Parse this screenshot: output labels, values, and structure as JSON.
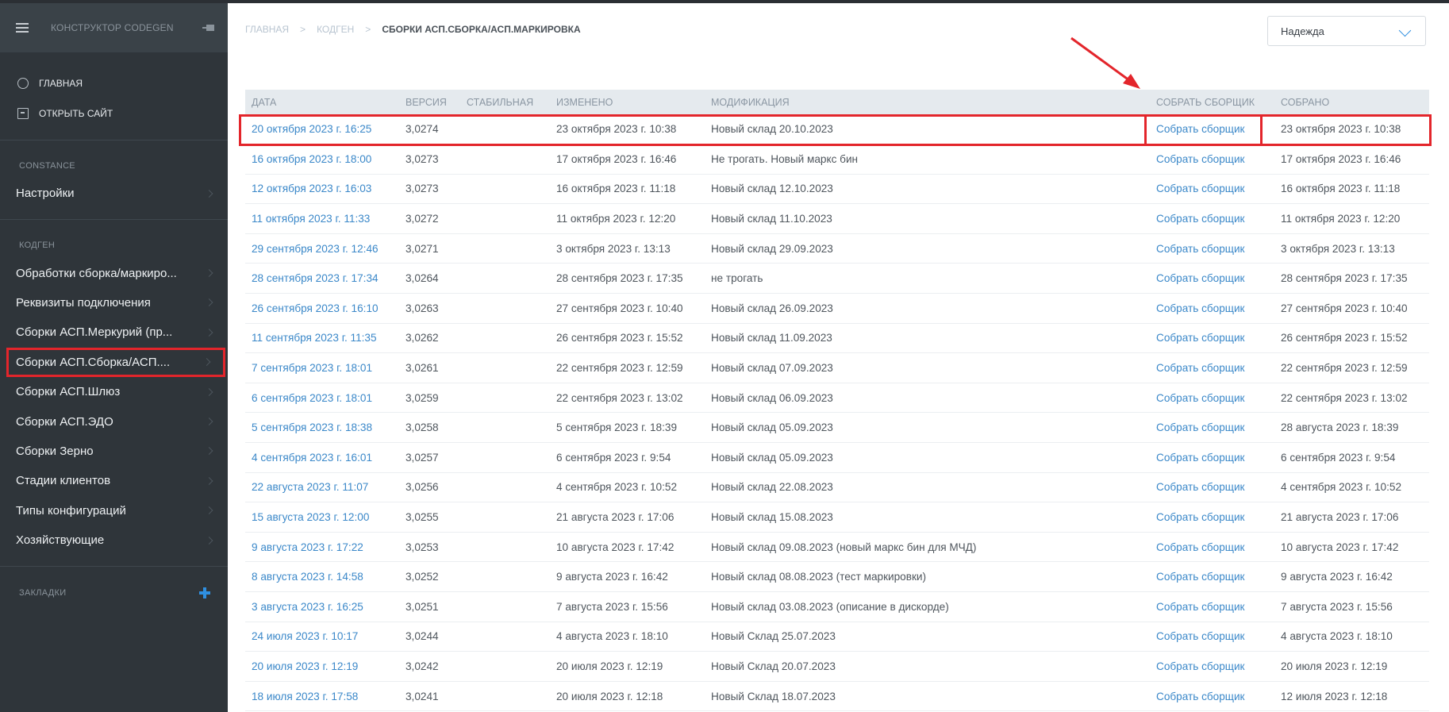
{
  "sidebar": {
    "title": "КОНСТРУКТОР CODEGEN",
    "links": [
      {
        "label": "ГЛАВНАЯ",
        "icon": "circle-icon"
      },
      {
        "label": "ОТКРЫТЬ САЙТ",
        "icon": "open-site-icon"
      }
    ],
    "sections": [
      {
        "title": "CONSTANCE",
        "items": [
          "Настройки"
        ]
      },
      {
        "title": "КОДГЕН",
        "items": [
          "Обработки сборка/маркиро...",
          "Реквизиты подключения",
          "Сборки АСП.Меркурий (пр...",
          "Сборки АСП.Сборка/АСП....",
          "Сборки АСП.Шлюз",
          "Сборки АСП.ЭДО",
          "Сборки Зерно",
          "Стадии клиентов",
          "Типы конфигураций",
          "Хозяйствующие"
        ]
      }
    ],
    "active_item": "Сборки АСП.Сборка/АСП....",
    "bookmarks_title": "ЗАКЛАДКИ"
  },
  "breadcrumb": {
    "home": "ГЛАВНАЯ",
    "section": "КОДГЕН",
    "current": "СБОРКИ АСП.СБОРКА/АСП.МАРКИРОВКА"
  },
  "user_select": {
    "value": "Надежда"
  },
  "colors": {
    "accent": "#3b88c9",
    "highlight": "#e3252b",
    "sidebar": "#2f353a"
  },
  "table": {
    "headers": {
      "date": "ДАТА",
      "version": "ВЕРСИЯ",
      "stable": "СТАБИЛЬНАЯ",
      "modified": "ИЗМЕНЕНО",
      "modification": "МОДИФИКАЦИЯ",
      "build": "СОБРАТЬ СБОРЩИК",
      "built": "СОБРАНО"
    },
    "rows": [
      {
        "date": "20 октября 2023 г. 16:25",
        "version": "3,0274",
        "stable": "",
        "modified": "23 октября 2023 г. 10:38",
        "modification": "Новый склад 20.10.2023",
        "build": "Собрать сборщик",
        "built": "23 октября 2023 г. 10:38"
      },
      {
        "date": "16 октября 2023 г. 18:00",
        "version": "3,0273",
        "stable": "",
        "modified": "17 октября 2023 г. 16:46",
        "modification": "Не трогать. Новый маркс бин",
        "build": "Собрать сборщик",
        "built": "17 октября 2023 г. 16:46"
      },
      {
        "date": "12 октября 2023 г. 16:03",
        "version": "3,0273",
        "stable": "",
        "modified": "16 октября 2023 г. 11:18",
        "modification": "Новый склад 12.10.2023",
        "build": "Собрать сборщик",
        "built": "16 октября 2023 г. 11:18"
      },
      {
        "date": "11 октября 2023 г. 11:33",
        "version": "3,0272",
        "stable": "",
        "modified": "11 октября 2023 г. 12:20",
        "modification": "Новый склад 11.10.2023",
        "build": "Собрать сборщик",
        "built": "11 октября 2023 г. 12:20"
      },
      {
        "date": "29 сентября 2023 г. 12:46",
        "version": "3,0271",
        "stable": "",
        "modified": "3 октября 2023 г. 13:13",
        "modification": "Новый склад 29.09.2023",
        "build": "Собрать сборщик",
        "built": "3 октября 2023 г. 13:13"
      },
      {
        "date": "28 сентября 2023 г. 17:34",
        "version": "3,0264",
        "stable": "",
        "modified": "28 сентября 2023 г. 17:35",
        "modification": "не трогать",
        "build": "Собрать сборщик",
        "built": "28 сентября 2023 г. 17:35"
      },
      {
        "date": "26 сентября 2023 г. 16:10",
        "version": "3,0263",
        "stable": "",
        "modified": "27 сентября 2023 г. 10:40",
        "modification": "Новый склад 26.09.2023",
        "build": "Собрать сборщик",
        "built": "27 сентября 2023 г. 10:40"
      },
      {
        "date": "11 сентября 2023 г. 11:35",
        "version": "3,0262",
        "stable": "",
        "modified": "26 сентября 2023 г. 15:52",
        "modification": "Новый склад 11.09.2023",
        "build": "Собрать сборщик",
        "built": "26 сентября 2023 г. 15:52"
      },
      {
        "date": "7 сентября 2023 г. 18:01",
        "version": "3,0261",
        "stable": "",
        "modified": "22 сентября 2023 г. 12:59",
        "modification": "Новый склад 07.09.2023",
        "build": "Собрать сборщик",
        "built": "22 сентября 2023 г. 12:59"
      },
      {
        "date": "6 сентября 2023 г. 18:01",
        "version": "3,0259",
        "stable": "",
        "modified": "22 сентября 2023 г. 13:02",
        "modification": "Новый склад 06.09.2023",
        "build": "Собрать сборщик",
        "built": "22 сентября 2023 г. 13:02"
      },
      {
        "date": "5 сентября 2023 г. 18:38",
        "version": "3,0258",
        "stable": "",
        "modified": "5 сентября 2023 г. 18:39",
        "modification": "Новый склад 05.09.2023",
        "build": "Собрать сборщик",
        "built": "28 августа 2023 г. 18:39"
      },
      {
        "date": "4 сентября 2023 г. 16:01",
        "version": "3,0257",
        "stable": "",
        "modified": "6 сентября 2023 г. 9:54",
        "modification": "Новый склад 05.09.2023",
        "build": "Собрать сборщик",
        "built": "6 сентября 2023 г. 9:54"
      },
      {
        "date": "22 августа 2023 г. 11:07",
        "version": "3,0256",
        "stable": "",
        "modified": "4 сентября 2023 г. 10:52",
        "modification": "Новый склад 22.08.2023",
        "build": "Собрать сборщик",
        "built": "4 сентября 2023 г. 10:52"
      },
      {
        "date": "15 августа 2023 г. 12:00",
        "version": "3,0255",
        "stable": "",
        "modified": "21 августа 2023 г. 17:06",
        "modification": "Новый склад 15.08.2023",
        "build": "Собрать сборщик",
        "built": "21 августа 2023 г. 17:06"
      },
      {
        "date": "9 августа 2023 г. 17:22",
        "version": "3,0253",
        "stable": "",
        "modified": "10 августа 2023 г. 17:42",
        "modification": "Новый склад 09.08.2023 (новый маркс бин для МЧД)",
        "build": "Собрать сборщик",
        "built": "10 августа 2023 г. 17:42"
      },
      {
        "date": "8 августа 2023 г. 14:58",
        "version": "3,0252",
        "stable": "",
        "modified": "9 августа 2023 г. 16:42",
        "modification": "Новый склад 08.08.2023 (тест маркировки)",
        "build": "Собрать сборщик",
        "built": "9 августа 2023 г. 16:42"
      },
      {
        "date": "3 августа 2023 г. 16:25",
        "version": "3,0251",
        "stable": "",
        "modified": "7 августа 2023 г. 15:56",
        "modification": "Новый склад 03.08.2023 (описание в дискорде)",
        "build": "Собрать сборщик",
        "built": "7 августа 2023 г. 15:56"
      },
      {
        "date": "24 июля 2023 г. 10:17",
        "version": "3,0244",
        "stable": "",
        "modified": "4 августа 2023 г. 18:10",
        "modification": "Новый Склад 25.07.2023",
        "build": "Собрать сборщик",
        "built": "4 августа 2023 г. 18:10"
      },
      {
        "date": "20 июля 2023 г. 12:19",
        "version": "3,0242",
        "stable": "",
        "modified": "20 июля 2023 г. 12:19",
        "modification": "Новый Склад 20.07.2023",
        "build": "Собрать сборщик",
        "built": "20 июля 2023 г. 12:19"
      },
      {
        "date": "18 июля 2023 г. 17:58",
        "version": "3,0241",
        "stable": "",
        "modified": "20 июля 2023 г. 12:18",
        "modification": "Новый Склад 18.07.2023",
        "build": "Собрать сборщик",
        "built": "12 июля 2023 г. 12:18"
      }
    ]
  }
}
